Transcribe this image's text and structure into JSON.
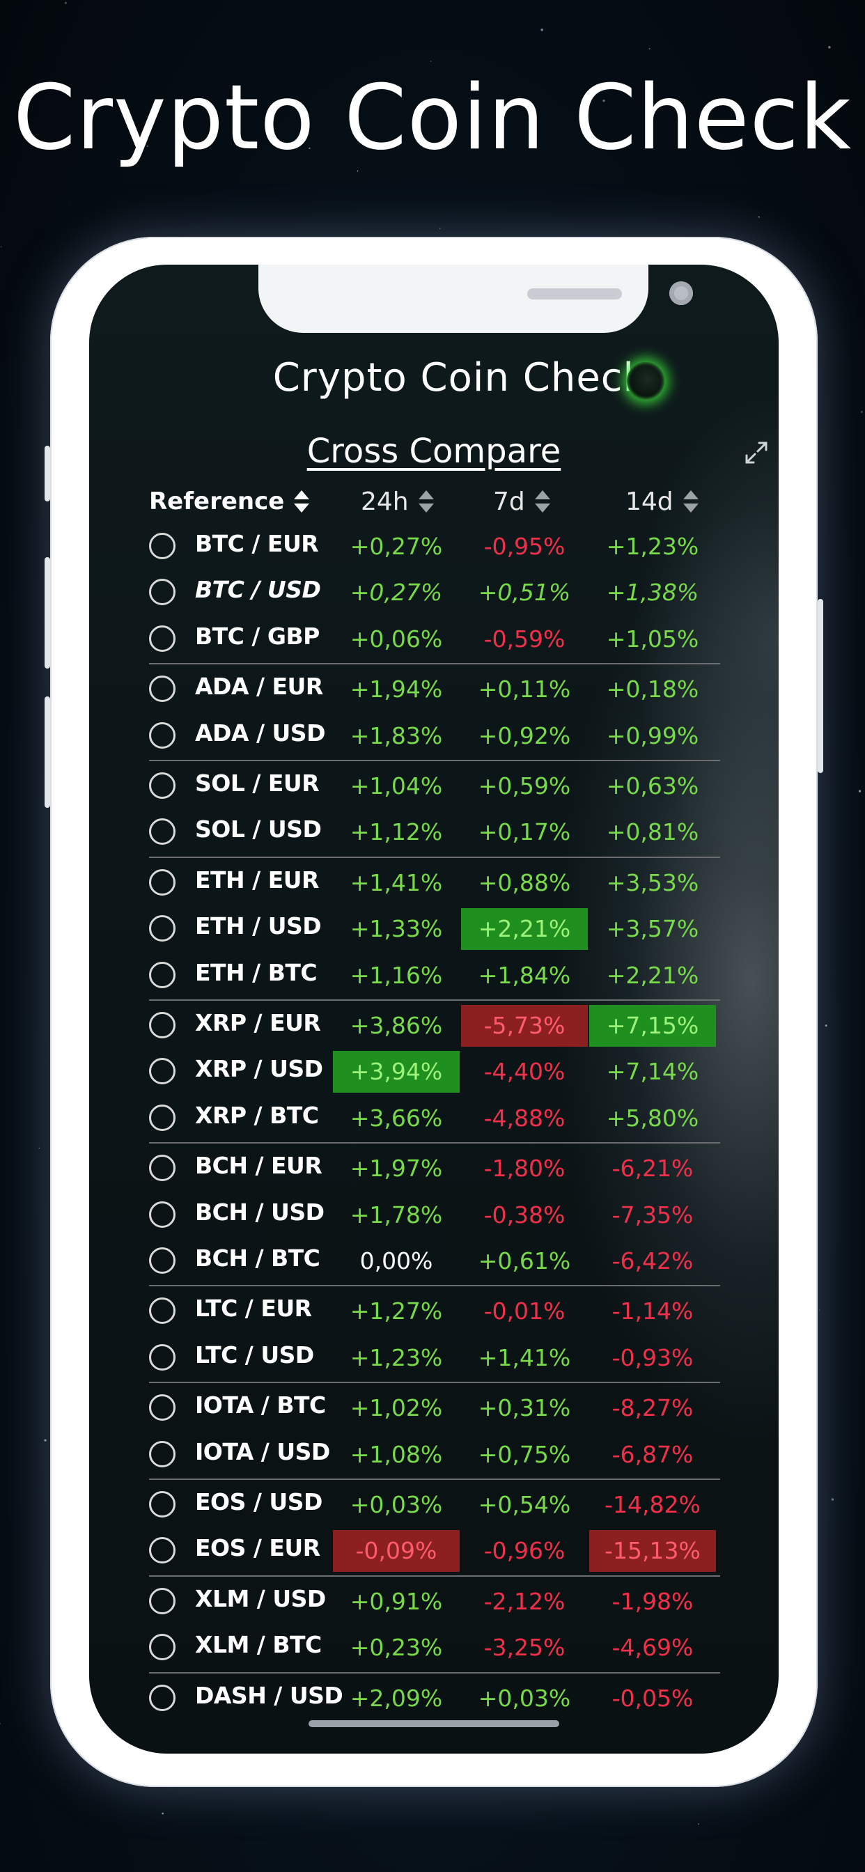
{
  "headline": "Crypto Coin Check",
  "app": {
    "title": "Crypto Coin Check",
    "section_title": "Cross Compare"
  },
  "columns": {
    "reference": "Reference",
    "h24": "24h",
    "d7": "7d",
    "d14": "14d"
  },
  "colors": {
    "positive": "#78d94a",
    "negative": "#f0304a",
    "highlight_positive": "#1f8f1f",
    "highlight_negative": "#8c1f1f"
  },
  "rows": [
    {
      "pair": "BTC / EUR",
      "h24": "+0,27%",
      "d7": "-0,95%",
      "d14": "+1,23%"
    },
    {
      "pair": "BTC / USD",
      "h24": "+0,27%",
      "d7": "+0,51%",
      "d14": "+1,38%",
      "reference": true
    },
    {
      "pair": "BTC / GBP",
      "h24": "+0,06%",
      "d7": "-0,59%",
      "d14": "+1,05%"
    },
    {
      "pair": "ADA / EUR",
      "h24": "+1,94%",
      "d7": "+0,11%",
      "d14": "+0,18%"
    },
    {
      "pair": "ADA / USD",
      "h24": "+1,83%",
      "d7": "+0,92%",
      "d14": "+0,99%"
    },
    {
      "pair": "SOL / EUR",
      "h24": "+1,04%",
      "d7": "+0,59%",
      "d14": "+0,63%"
    },
    {
      "pair": "SOL / USD",
      "h24": "+1,12%",
      "d7": "+0,17%",
      "d14": "+0,81%"
    },
    {
      "pair": "ETH / EUR",
      "h24": "+1,41%",
      "d7": "+0,88%",
      "d14": "+3,53%"
    },
    {
      "pair": "ETH / USD",
      "h24": "+1,33%",
      "d7": "+2,21%",
      "d14": "+3,57%",
      "highlight": "d7"
    },
    {
      "pair": "ETH / BTC",
      "h24": "+1,16%",
      "d7": "+1,84%",
      "d14": "+2,21%"
    },
    {
      "pair": "XRP / EUR",
      "h24": "+3,86%",
      "d7": "-5,73%",
      "d14": "+7,15%",
      "highlight": "d7,d14"
    },
    {
      "pair": "XRP / USD",
      "h24": "+3,94%",
      "d7": "-4,40%",
      "d14": "+7,14%",
      "highlight": "h24"
    },
    {
      "pair": "XRP / BTC",
      "h24": "+3,66%",
      "d7": "-4,88%",
      "d14": "+5,80%"
    },
    {
      "pair": "BCH / EUR",
      "h24": "+1,97%",
      "d7": "-1,80%",
      "d14": "-6,21%"
    },
    {
      "pair": "BCH / USD",
      "h24": "+1,78%",
      "d7": "-0,38%",
      "d14": "-7,35%"
    },
    {
      "pair": "BCH / BTC",
      "h24": "0,00%",
      "d7": "+0,61%",
      "d14": "-6,42%"
    },
    {
      "pair": "LTC / EUR",
      "h24": "+1,27%",
      "d7": "-0,01%",
      "d14": "-1,14%"
    },
    {
      "pair": "LTC / USD",
      "h24": "+1,23%",
      "d7": "+1,41%",
      "d14": "-0,93%"
    },
    {
      "pair": "IOTA / BTC",
      "h24": "+1,02%",
      "d7": "+0,31%",
      "d14": "-8,27%"
    },
    {
      "pair": "IOTA / USD",
      "h24": "+1,08%",
      "d7": "+0,75%",
      "d14": "-6,87%"
    },
    {
      "pair": "EOS / USD",
      "h24": "+0,03%",
      "d7": "+0,54%",
      "d14": "-14,82%"
    },
    {
      "pair": "EOS / EUR",
      "h24": "-0,09%",
      "d7": "-0,96%",
      "d14": "-15,13%",
      "highlight": "h24,d14"
    },
    {
      "pair": "XLM / USD",
      "h24": "+0,91%",
      "d7": "-2,12%",
      "d14": "-1,98%"
    },
    {
      "pair": "XLM / BTC",
      "h24": "+0,23%",
      "d7": "-3,25%",
      "d14": "-4,69%"
    },
    {
      "pair": "DASH / USD",
      "h24": "+2,09%",
      "d7": "+0,03%",
      "d14": "-0,05%"
    }
  ]
}
